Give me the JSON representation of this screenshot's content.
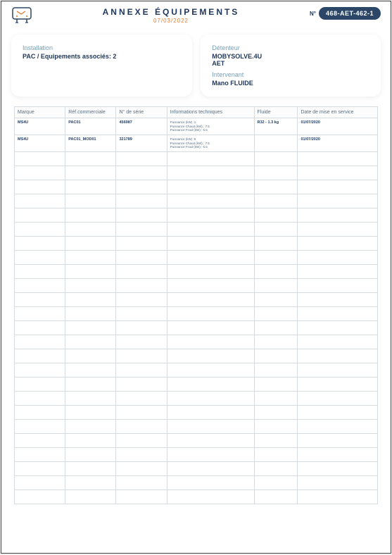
{
  "header": {
    "title": "ANNEXE ÉQUIPEMENTS",
    "date": "07/03/2022",
    "num_prefix": "N°",
    "num": "468-AET-462-1"
  },
  "installation": {
    "label": "Installation",
    "value": "PAC / Equipements associés: 2"
  },
  "detenteur": {
    "label": "Détenteur",
    "line1": "MOBYSOLVE.4U",
    "line2": "AET"
  },
  "intervenant": {
    "label": "Intervenant",
    "value": "Mano FLUIDE"
  },
  "table": {
    "headers": {
      "marque": "Marque",
      "ref": "Réf.commerciale",
      "serie": "N° de série",
      "info": "Informations techniques",
      "fluide": "Fluide",
      "date": "Date de mise en service"
    },
    "rows": [
      {
        "marque": "MS4U",
        "ref": "PAC01",
        "serie": "456987",
        "info": "Puissance (kW) :1\nPuissance Chaud (kW) : 7.5\nPuissance Froid (kW) : 6.5",
        "fluide": "R32 - 1.3 kg",
        "date": "01/07/2020"
      },
      {
        "marque": "MS4U",
        "ref": "PAC01_MOD01",
        "serie": "321789",
        "info": "Puissance (kW) :6\nPuissance Chaud (kW) : 7.5\nPuissance Froid (kW) : 6.5",
        "fluide": "",
        "date": "01/07/2020"
      }
    ],
    "empty_rows": 25
  }
}
